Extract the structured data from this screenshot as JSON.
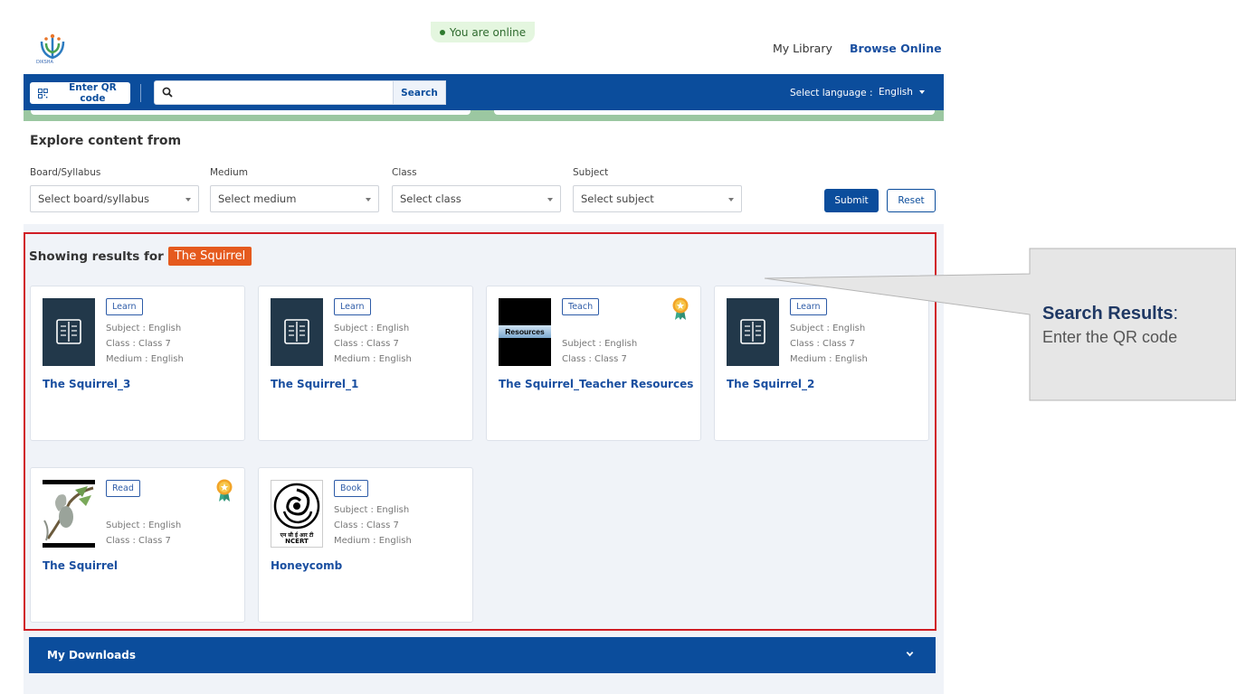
{
  "header": {
    "logo_text": "DIKSHA",
    "online_status": "You are online",
    "nav": {
      "my_library": "My Library",
      "browse_online": "Browse Online"
    }
  },
  "toolbar": {
    "qr_label": "Enter QR code",
    "search_placeholder": "",
    "search_label": "Search",
    "language_label": "Select language :",
    "language_value": "English"
  },
  "explore": {
    "title": "Explore content from",
    "filters": [
      {
        "label": "Board/Syllabus",
        "placeholder": "Select board/syllabus"
      },
      {
        "label": "Medium",
        "placeholder": "Select medium"
      },
      {
        "label": "Class",
        "placeholder": "Select class"
      },
      {
        "label": "Subject",
        "placeholder": "Select subject"
      }
    ],
    "submit_label": "Submit",
    "reset_label": "Reset"
  },
  "results": {
    "prefix": "Showing results for",
    "query": "The Squirrel",
    "cards": [
      {
        "tag": "Learn",
        "subject": "Subject : English",
        "class": "Class : Class 7",
        "medium": "Medium : English",
        "title": "The Squirrel_3",
        "thumb": "book-icon",
        "badge": false
      },
      {
        "tag": "Learn",
        "subject": "Subject : English",
        "class": "Class : Class 7",
        "medium": "Medium : English",
        "title": "The Squirrel_1",
        "thumb": "book-icon",
        "badge": false
      },
      {
        "tag": "Teach",
        "subject": "Subject : English",
        "class": "Class : Class 7",
        "medium": "",
        "title": "The Squirrel_Teacher Resources",
        "thumb": "resources",
        "thumb_text": "Resources",
        "badge": true
      },
      {
        "tag": "Learn",
        "subject": "Subject : English",
        "class": "Class : Class 7",
        "medium": "Medium : English",
        "title": "The Squirrel_2",
        "thumb": "book-icon",
        "badge": false
      },
      {
        "tag": "Read",
        "subject": "Subject : English",
        "class": "Class : Class 7",
        "medium": "",
        "title": "The Squirrel",
        "thumb": "squirrel-image",
        "badge": true
      },
      {
        "tag": "Book",
        "subject": "Subject : English",
        "class": "Class : Class 7",
        "medium": "Medium : English",
        "title": "Honeycomb",
        "thumb": "ncert-logo",
        "thumb_text": "एन सी ई आर टी",
        "thumb_text2": "NCERT",
        "badge": false
      }
    ]
  },
  "downloads": {
    "label": "My Downloads"
  },
  "callout": {
    "title": "Search Results",
    "colon": ":",
    "subtitle": "Enter the QR code"
  },
  "colors": {
    "primary": "#0b4d9c",
    "highlight": "#e55a1e",
    "frame": "#d01c24",
    "online_bg": "#e4f6df"
  }
}
